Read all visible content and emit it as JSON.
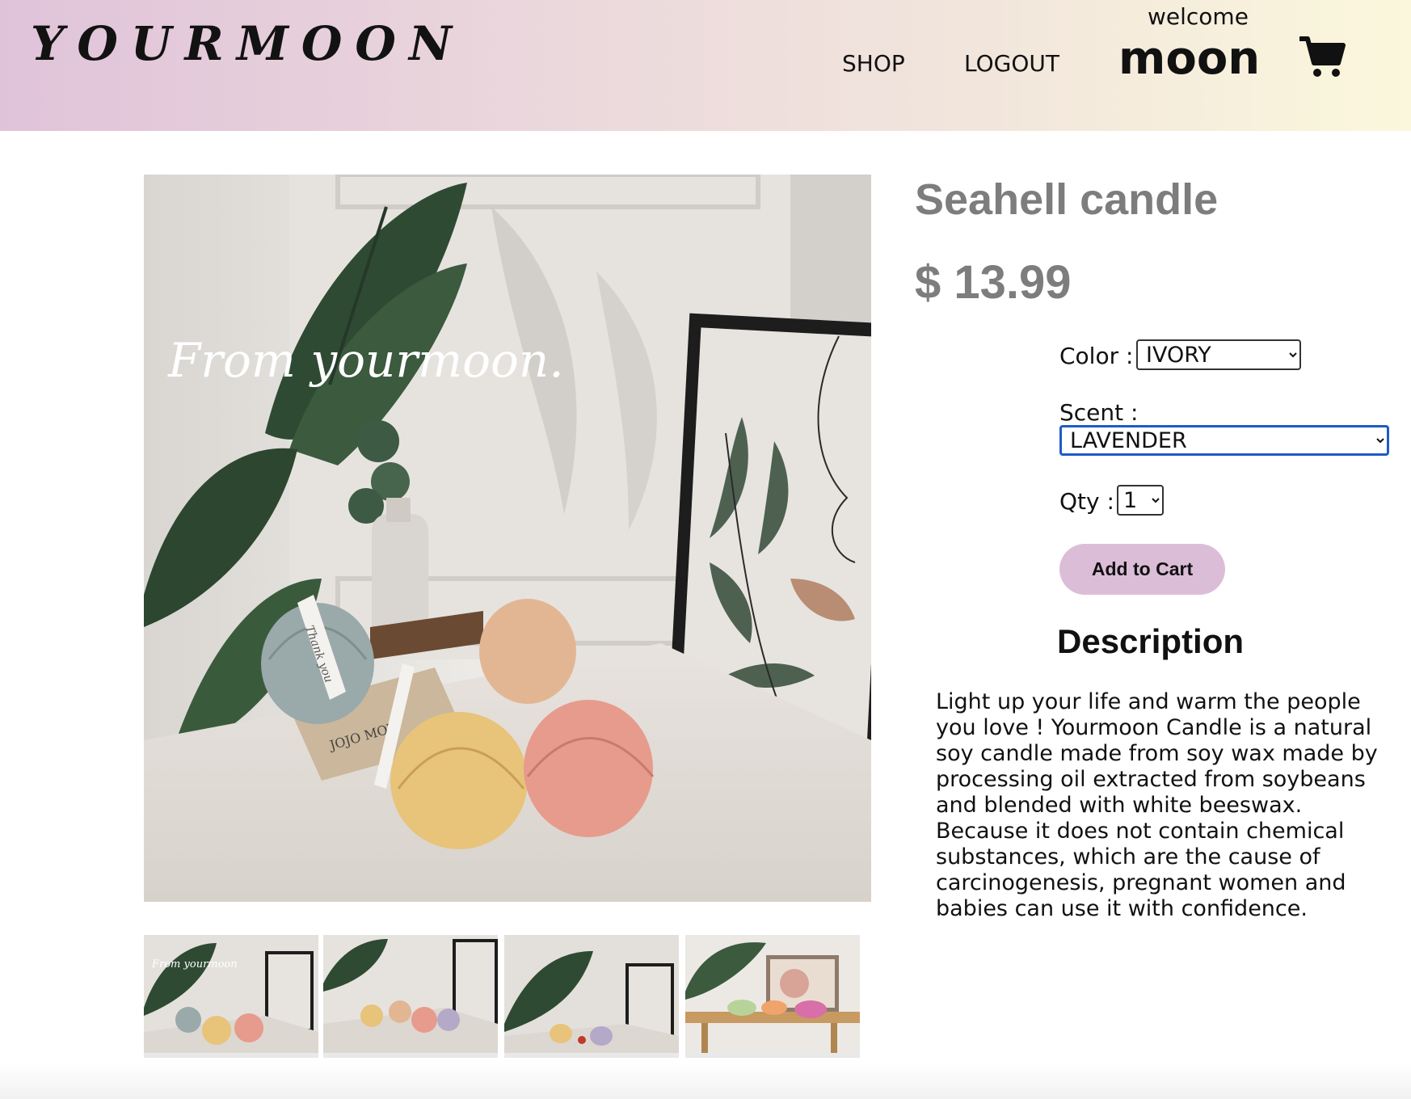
{
  "header": {
    "logo": "YOURMOON",
    "nav": {
      "shop": "SHOP",
      "logout": "LOGOUT"
    },
    "welcome": "welcome",
    "username": "moon",
    "cart_icon": "cart-icon"
  },
  "product": {
    "title": "Seahell candle",
    "price": "$ 13.99",
    "main_image": {
      "overlay_text": "From yourmoon.",
      "book_text": "JOJO MOY",
      "tag_text": "Thank you"
    },
    "thumbnails": [
      {
        "overlay_text": "From yourmoon"
      },
      {
        "overlay_text": ""
      },
      {
        "overlay_text": ""
      },
      {
        "overlay_text": ""
      }
    ],
    "options": {
      "color_label": "Color :",
      "color_value": "IVORY",
      "scent_label": "Scent :",
      "scent_value": "LAVENDER",
      "qty_label": "Qty :",
      "qty_value": "1"
    },
    "add_to_cart": "Add to Cart",
    "description_heading": "Description",
    "description": "Light up your life and warm the people you love !  Yourmoon Candle is a natural soy candle made from soy wax made by processing oil extracted from soybeans and blended with white beeswax. Because it does not contain chemical substances, which are the cause of carcinogenesis, pregnant women and babies can use it with confidence."
  },
  "colors": {
    "header_start": "#e0c3d9",
    "header_end": "#fbf7dc",
    "button_bg": "#dcbdd8",
    "title_gray": "#7d7d7d",
    "focus_blue": "#1f5bc7"
  }
}
